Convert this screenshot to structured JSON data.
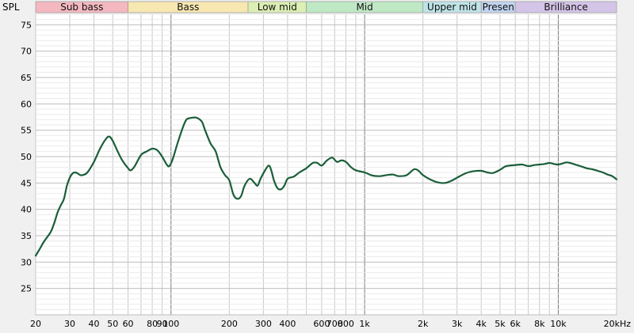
{
  "chart_data": {
    "type": "line",
    "title": "",
    "ylabel": "SPL",
    "xlabel": "",
    "xscale": "log",
    "xlim": [
      20,
      20000
    ],
    "ylim": [
      20,
      77
    ],
    "grid": true,
    "y_ticks": [
      25,
      30,
      35,
      40,
      45,
      50,
      55,
      60,
      65,
      70,
      75
    ],
    "x_ticks": [
      {
        "value": 20,
        "label": "20"
      },
      {
        "value": 30,
        "label": "30"
      },
      {
        "value": 40,
        "label": "40"
      },
      {
        "value": 50,
        "label": "50"
      },
      {
        "value": 60,
        "label": "60"
      },
      {
        "value": 80,
        "label": "80"
      },
      {
        "value": 90,
        "label": "90"
      },
      {
        "value": 100,
        "label": "100"
      },
      {
        "value": 200,
        "label": "200"
      },
      {
        "value": 300,
        "label": "300"
      },
      {
        "value": 400,
        "label": "400"
      },
      {
        "value": 600,
        "label": "600"
      },
      {
        "value": 700,
        "label": "700"
      },
      {
        "value": 800,
        "label": "800"
      },
      {
        "value": 1000,
        "label": "1k"
      },
      {
        "value": 2000,
        "label": "2k"
      },
      {
        "value": 3000,
        "label": "3k"
      },
      {
        "value": 4000,
        "label": "4k"
      },
      {
        "value": 5000,
        "label": "5k"
      },
      {
        "value": 6000,
        "label": "6k"
      },
      {
        "value": 8000,
        "label": "8k"
      },
      {
        "value": 10000,
        "label": "10k"
      },
      {
        "value": 20000,
        "label": "20kHz"
      }
    ],
    "bands": [
      {
        "name": "Sub bass",
        "from": 20,
        "to": 60,
        "color": "#f4b8c0"
      },
      {
        "name": "Bass",
        "from": 60,
        "to": 250,
        "color": "#f7e7b0"
      },
      {
        "name": "Low mid",
        "from": 250,
        "to": 500,
        "color": "#dcefb4"
      },
      {
        "name": "Mid",
        "from": 500,
        "to": 2000,
        "color": "#bfe8c4"
      },
      {
        "name": "Upper mid",
        "from": 2000,
        "to": 4000,
        "color": "#bfe4e8"
      },
      {
        "name": "Presen",
        "from": 4000,
        "to": 6000,
        "color": "#c2d4f0"
      },
      {
        "name": "Brilliance",
        "from": 6000,
        "to": 20000,
        "color": "#d4c4e8"
      }
    ],
    "series": [
      {
        "color": "#1a5e3a",
        "points": [
          [
            20,
            31.2
          ],
          [
            21,
            32.5
          ],
          [
            22,
            33.8
          ],
          [
            23,
            34.8
          ],
          [
            24,
            35.8
          ],
          [
            25,
            37.5
          ],
          [
            26,
            39.5
          ],
          [
            27,
            40.8
          ],
          [
            28,
            42.0
          ],
          [
            29,
            44.5
          ],
          [
            30,
            46.0
          ],
          [
            31,
            46.8
          ],
          [
            32,
            47.0
          ],
          [
            33,
            46.8
          ],
          [
            34,
            46.5
          ],
          [
            35,
            46.5
          ],
          [
            37,
            47.0
          ],
          [
            40,
            49.0
          ],
          [
            43,
            51.5
          ],
          [
            46,
            53.3
          ],
          [
            48,
            53.8
          ],
          [
            50,
            53.0
          ],
          [
            53,
            51.0
          ],
          [
            56,
            49.3
          ],
          [
            60,
            47.8
          ],
          [
            62,
            47.4
          ],
          [
            65,
            48.2
          ],
          [
            70,
            50.3
          ],
          [
            75,
            51.0
          ],
          [
            80,
            51.5
          ],
          [
            85,
            51.2
          ],
          [
            90,
            50.0
          ],
          [
            95,
            48.5
          ],
          [
            98,
            48.2
          ],
          [
            102,
            49.5
          ],
          [
            108,
            52.5
          ],
          [
            115,
            55.5
          ],
          [
            120,
            57.0
          ],
          [
            125,
            57.3
          ],
          [
            130,
            57.4
          ],
          [
            135,
            57.4
          ],
          [
            140,
            57.1
          ],
          [
            145,
            56.5
          ],
          [
            150,
            55.0
          ],
          [
            160,
            52.5
          ],
          [
            170,
            51.0
          ],
          [
            180,
            48.0
          ],
          [
            190,
            46.5
          ],
          [
            200,
            45.5
          ],
          [
            210,
            42.8
          ],
          [
            220,
            42.0
          ],
          [
            230,
            42.5
          ],
          [
            240,
            44.5
          ],
          [
            255,
            45.8
          ],
          [
            270,
            45.0
          ],
          [
            280,
            44.5
          ],
          [
            290,
            45.8
          ],
          [
            305,
            47.3
          ],
          [
            320,
            48.3
          ],
          [
            330,
            47.3
          ],
          [
            340,
            45.5
          ],
          [
            355,
            44.0
          ],
          [
            370,
            43.8
          ],
          [
            385,
            44.5
          ],
          [
            400,
            45.8
          ],
          [
            430,
            46.2
          ],
          [
            460,
            47.0
          ],
          [
            500,
            47.8
          ],
          [
            540,
            48.8
          ],
          [
            570,
            48.8
          ],
          [
            600,
            48.3
          ],
          [
            640,
            49.3
          ],
          [
            680,
            49.8
          ],
          [
            720,
            49.0
          ],
          [
            760,
            49.3
          ],
          [
            800,
            49.0
          ],
          [
            850,
            48.0
          ],
          [
            900,
            47.4
          ],
          [
            1000,
            47.0
          ],
          [
            1100,
            46.4
          ],
          [
            1200,
            46.3
          ],
          [
            1300,
            46.5
          ],
          [
            1400,
            46.6
          ],
          [
            1500,
            46.3
          ],
          [
            1650,
            46.5
          ],
          [
            1800,
            47.6
          ],
          [
            1900,
            47.3
          ],
          [
            2000,
            46.5
          ],
          [
            2200,
            45.6
          ],
          [
            2400,
            45.1
          ],
          [
            2600,
            45.0
          ],
          [
            2800,
            45.4
          ],
          [
            3000,
            46.0
          ],
          [
            3300,
            46.8
          ],
          [
            3600,
            47.2
          ],
          [
            4000,
            47.3
          ],
          [
            4300,
            47.0
          ],
          [
            4600,
            46.9
          ],
          [
            5000,
            47.5
          ],
          [
            5300,
            48.1
          ],
          [
            5600,
            48.3
          ],
          [
            6000,
            48.4
          ],
          [
            6500,
            48.5
          ],
          [
            7000,
            48.2
          ],
          [
            7500,
            48.4
          ],
          [
            8000,
            48.5
          ],
          [
            8500,
            48.6
          ],
          [
            9000,
            48.8
          ],
          [
            9500,
            48.6
          ],
          [
            10000,
            48.5
          ],
          [
            10500,
            48.7
          ],
          [
            11000,
            48.9
          ],
          [
            11500,
            48.8
          ],
          [
            12000,
            48.6
          ],
          [
            13000,
            48.2
          ],
          [
            14000,
            47.8
          ],
          [
            15000,
            47.6
          ],
          [
            16000,
            47.3
          ],
          [
            17000,
            47.0
          ],
          [
            18000,
            46.6
          ],
          [
            19000,
            46.3
          ],
          [
            20000,
            45.7
          ]
        ]
      }
    ]
  }
}
